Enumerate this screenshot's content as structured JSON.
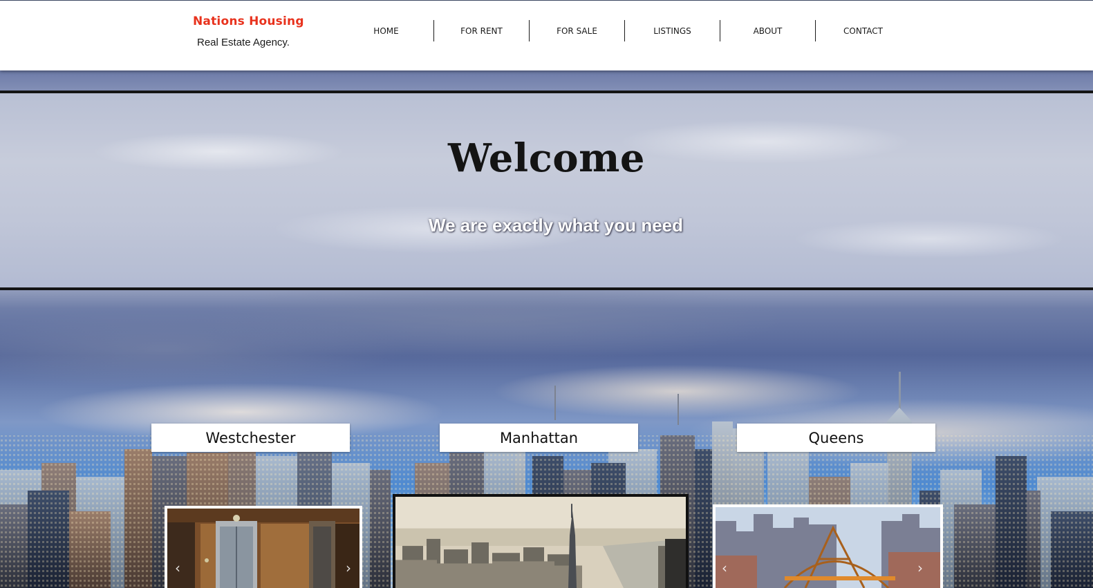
{
  "brand": {
    "name": "Nations Housing",
    "tagline": "Real Estate Agency."
  },
  "nav": {
    "items": [
      "HOME",
      "FOR RENT",
      "FOR SALE",
      "LISTINGS",
      "ABOUT",
      "CONTACT"
    ]
  },
  "hero": {
    "title": "Welcome",
    "subtitle": "We are exactly what you need"
  },
  "locations": [
    "Westchester",
    "Manhattan",
    "Queens"
  ],
  "colors": {
    "brand_red": "#e8321d",
    "text_dark": "#141414",
    "header_bg": "#ffffff"
  },
  "icons": {
    "gallery_prev": "chevron-left-icon",
    "gallery_next": "chevron-right-icon"
  }
}
